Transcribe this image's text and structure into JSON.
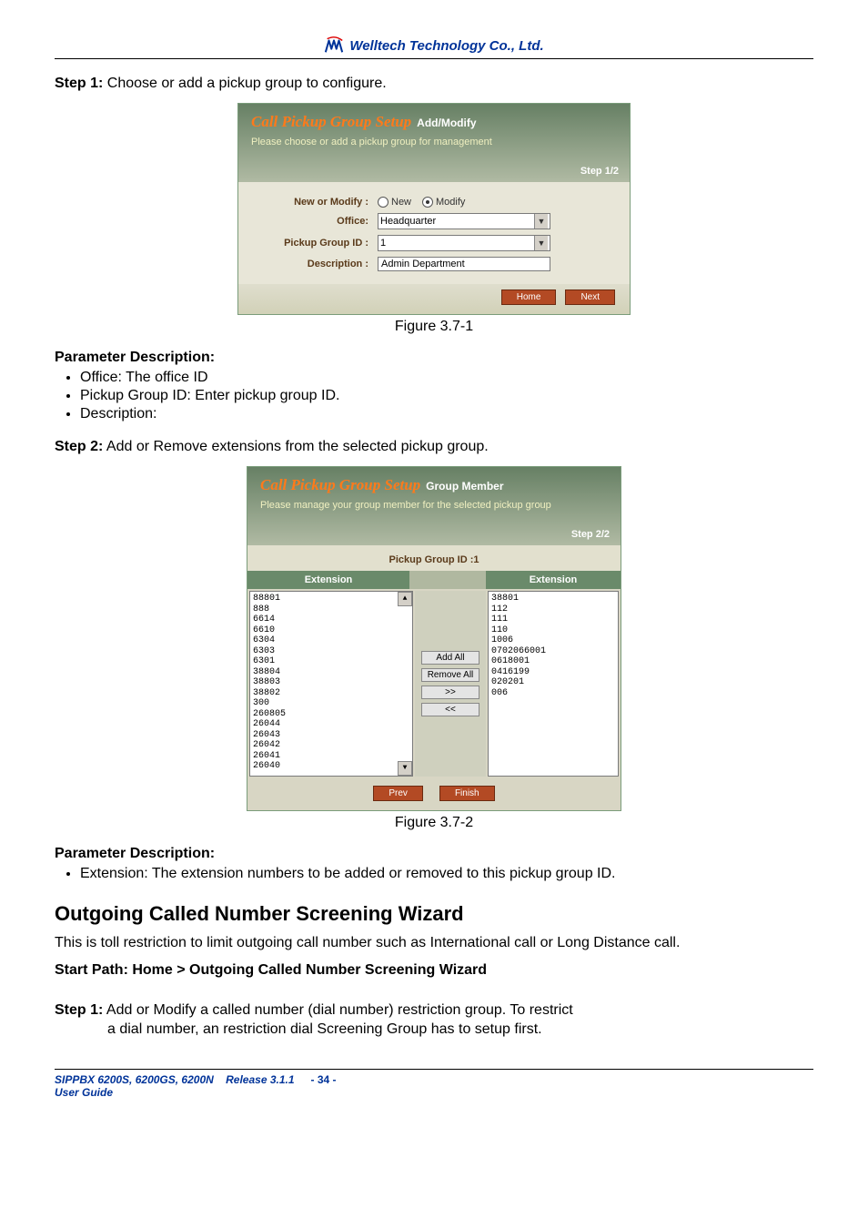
{
  "header": {
    "company": "Welltech Technology Co., Ltd."
  },
  "step1_line": {
    "prefix": "Step 1:",
    "text": " Choose or add a pickup group to configure."
  },
  "fig1": {
    "title_left": "Call Pickup Group Setup",
    "title_right": "Add/Modify",
    "subtitle": "Please choose or add a pickup group for management",
    "step_badge": "Step 1/2",
    "labels": {
      "new_or_modify": "New or Modify :",
      "office": "Office:",
      "pickup_group_id": "Pickup Group ID :",
      "description": "Description :"
    },
    "radio": {
      "new": "New",
      "modify": "Modify"
    },
    "values": {
      "office": "Headquarter",
      "pickup_group_id": "1",
      "description": "Admin Department"
    },
    "buttons": {
      "home": "Home",
      "next": "Next"
    },
    "caption": "Figure 3.7-1"
  },
  "pd1": {
    "heading": "Parameter Description:",
    "items": [
      "Office: The office ID",
      "Pickup Group ID: Enter pickup group ID.",
      "Description:"
    ]
  },
  "step2_line": {
    "prefix": "Step 2:",
    "text": " Add or Remove extensions from the selected pickup group."
  },
  "fig2": {
    "title_left": "Call Pickup Group Setup",
    "title_right": "Group Member",
    "subtitle": "Please manage your group member for the selected pickup group",
    "step_badge": "Step 2/2",
    "pg_id_label": "Pickup Group ID :1",
    "col_ext": "Extension",
    "left_list": [
      "88801",
      "888",
      "6614",
      "6610",
      "6304",
      "6303",
      "6301",
      "38804",
      "38803",
      "38802",
      "300",
      "260805",
      "26044",
      "26043",
      "26042",
      "26041",
      "26040"
    ],
    "right_list": [
      "38801",
      "112",
      "111",
      "110",
      "1006",
      "0702066001",
      "0618001",
      "0416199",
      "020201",
      "006"
    ],
    "mid_buttons": {
      "add_all": "Add All",
      "remove_all": "Remove All",
      "right": ">>",
      "left": "<<"
    },
    "buttons": {
      "prev": "Prev",
      "finish": "Finish"
    },
    "caption": "Figure 3.7-2"
  },
  "pd2": {
    "heading": "Parameter Description:",
    "items": [
      "Extension: The extension numbers to be added or removed to this pickup group ID."
    ]
  },
  "section_heading": "Outgoing Called Number Screening Wizard",
  "section_body": "This is toll restriction to limit outgoing call number such as International call or Long Distance call.",
  "start_path": "Start Path: Home > Outgoing Called Number Screening Wizard",
  "step1b": {
    "prefix": "Step 1:",
    "line1": " Add or Modify a called number (dial number) restriction group. To restrict",
    "line2": "a dial number, an restriction dial Screening Group has to setup first."
  },
  "footer": {
    "product": "SIPPBX 6200S, 6200GS, 6200N",
    "release": "Release 3.1.1",
    "guide": "User Guide",
    "page": "- 34 -"
  }
}
